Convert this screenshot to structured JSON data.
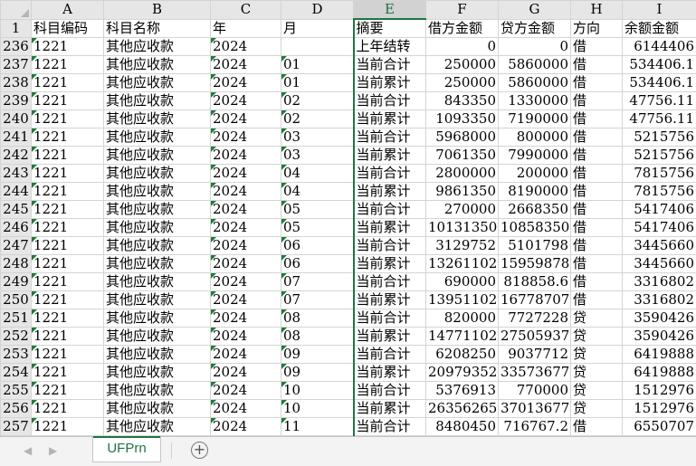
{
  "sheet": {
    "columns": [
      "A",
      "B",
      "C",
      "D",
      "E",
      "F",
      "G",
      "H",
      "I"
    ],
    "rows": [
      {
        "rn": "1",
        "cells": [
          "科目编码",
          "科目名称",
          "年",
          "月",
          "摘要",
          "借方金额",
          "贷方金额",
          "方向",
          "余额金额"
        ],
        "header": true
      },
      {
        "rn": "236",
        "cells": [
          "1221",
          "其他应收款",
          "2024",
          "",
          "上年结转",
          "0",
          "0",
          "借",
          "6144406"
        ]
      },
      {
        "rn": "237",
        "cells": [
          "1221",
          "其他应收款",
          "2024",
          "01",
          "当前合计",
          "250000",
          "5860000",
          "借",
          "534406.1"
        ]
      },
      {
        "rn": "238",
        "cells": [
          "1221",
          "其他应收款",
          "2024",
          "01",
          "当前累计",
          "250000",
          "5860000",
          "借",
          "534406.1"
        ]
      },
      {
        "rn": "239",
        "cells": [
          "1221",
          "其他应收款",
          "2024",
          "02",
          "当前合计",
          "843350",
          "1330000",
          "借",
          "47756.11"
        ]
      },
      {
        "rn": "240",
        "cells": [
          "1221",
          "其他应收款",
          "2024",
          "02",
          "当前累计",
          "1093350",
          "7190000",
          "借",
          "47756.11"
        ]
      },
      {
        "rn": "241",
        "cells": [
          "1221",
          "其他应收款",
          "2024",
          "03",
          "当前合计",
          "5968000",
          "800000",
          "借",
          "5215756"
        ]
      },
      {
        "rn": "242",
        "cells": [
          "1221",
          "其他应收款",
          "2024",
          "03",
          "当前累计",
          "7061350",
          "7990000",
          "借",
          "5215756"
        ]
      },
      {
        "rn": "243",
        "cells": [
          "1221",
          "其他应收款",
          "2024",
          "04",
          "当前合计",
          "2800000",
          "200000",
          "借",
          "7815756"
        ]
      },
      {
        "rn": "244",
        "cells": [
          "1221",
          "其他应收款",
          "2024",
          "04",
          "当前累计",
          "9861350",
          "8190000",
          "借",
          "7815756"
        ]
      },
      {
        "rn": "245",
        "cells": [
          "1221",
          "其他应收款",
          "2024",
          "05",
          "当前合计",
          "270000",
          "2668350",
          "借",
          "5417406"
        ]
      },
      {
        "rn": "246",
        "cells": [
          "1221",
          "其他应收款",
          "2024",
          "05",
          "当前累计",
          "10131350",
          "10858350",
          "借",
          "5417406"
        ]
      },
      {
        "rn": "247",
        "cells": [
          "1221",
          "其他应收款",
          "2024",
          "06",
          "当前合计",
          "3129752",
          "5101798",
          "借",
          "3445660"
        ]
      },
      {
        "rn": "248",
        "cells": [
          "1221",
          "其他应收款",
          "2024",
          "06",
          "当前累计",
          "13261102",
          "15959878",
          "借",
          "3445660"
        ]
      },
      {
        "rn": "249",
        "cells": [
          "1221",
          "其他应收款",
          "2024",
          "07",
          "当前合计",
          "690000",
          "818858.6",
          "借",
          "3316802"
        ]
      },
      {
        "rn": "250",
        "cells": [
          "1221",
          "其他应收款",
          "2024",
          "07",
          "当前累计",
          "13951102",
          "16778707",
          "借",
          "3316802"
        ]
      },
      {
        "rn": "251",
        "cells": [
          "1221",
          "其他应收款",
          "2024",
          "08",
          "当前合计",
          "820000",
          "7727228",
          "贷",
          "3590426"
        ]
      },
      {
        "rn": "252",
        "cells": [
          "1221",
          "其他应收款",
          "2024",
          "08",
          "当前累计",
          "14771102",
          "27505937",
          "贷",
          "3590426"
        ]
      },
      {
        "rn": "253",
        "cells": [
          "1221",
          "其他应收款",
          "2024",
          "09",
          "当前合计",
          "6208250",
          "9037712",
          "贷",
          "6419888"
        ]
      },
      {
        "rn": "254",
        "cells": [
          "1221",
          "其他应收款",
          "2024",
          "09",
          "当前累计",
          "20979352",
          "33573677",
          "贷",
          "6419888"
        ]
      },
      {
        "rn": "255",
        "cells": [
          "1221",
          "其他应收款",
          "2024",
          "10",
          "当前合计",
          "5376913",
          "770000",
          "贷",
          "1512976"
        ]
      },
      {
        "rn": "256",
        "cells": [
          "1221",
          "其他应收款",
          "2024",
          "10",
          "当前累计",
          "26356265",
          "37013677",
          "贷",
          "1512976"
        ]
      },
      {
        "rn": "257",
        "cells": [
          "1221",
          "其他应收款",
          "2024",
          "11",
          "当前合计",
          "8480450",
          "716767.2",
          "借",
          "6550707"
        ]
      }
    ]
  },
  "tabs": {
    "prev_icon": "◀",
    "next_icon": "▶",
    "active_sheet": "UFPrn",
    "add_icon": "+"
  },
  "colors": {
    "accent": "#217346",
    "header_bg": "#e6e6e6",
    "gridline": "#d4d4d4"
  }
}
